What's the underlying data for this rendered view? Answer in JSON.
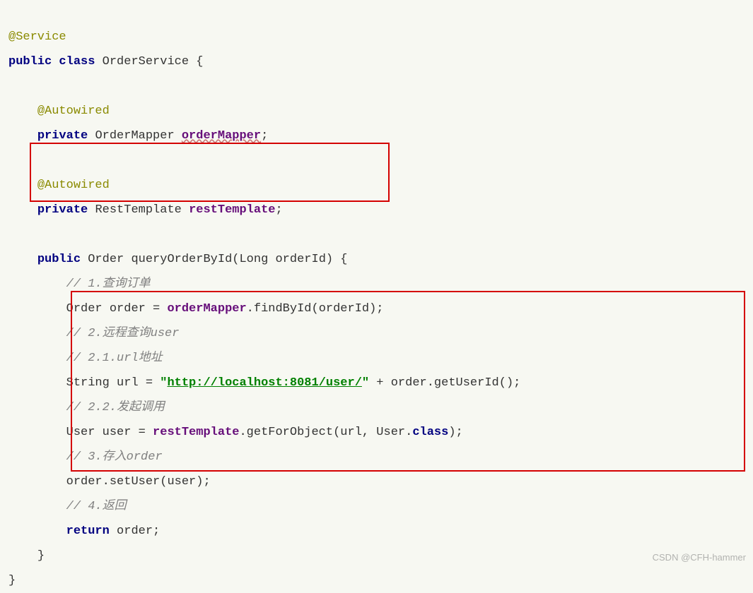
{
  "code": {
    "l1_annotation": "@Service",
    "l2_kw1": "public",
    "l2_kw2": "class",
    "l2_class": "OrderService {",
    "l4_annotation": "@Autowired",
    "l5_kw": "private",
    "l5_type": "OrderMapper",
    "l5_field": "orderMapper",
    "l5_semi": ";",
    "l7_annotation": "@Autowired",
    "l8_kw": "private",
    "l8_type": "RestTemplate",
    "l8_field": "restTemplate",
    "l8_semi": ";",
    "l10_kw": "public",
    "l10_rest": "Order queryOrderById(Long orderId) {",
    "l11_comment": "// 1.查询订单",
    "l12_a": "Order order = ",
    "l12_field": "orderMapper",
    "l12_b": ".findById(orderId);",
    "l13_comment": "// 2.远程查询user",
    "l14_comment": "// 2.1.url地址",
    "l15_a": "String url = ",
    "l15_str_q1": "\"",
    "l15_str_url": "http://localhost:8081/user/",
    "l15_str_q2": "\"",
    "l15_b": " + order.getUserId();",
    "l16_comment": "// 2.2.发起调用",
    "l17_a": "User user = ",
    "l17_field": "restTemplate",
    "l17_b": ".getForObject(url, User.",
    "l17_kw": "class",
    "l17_c": ");",
    "l18_comment": "// 3.存入order",
    "l19": "order.setUser(user);",
    "l20_comment": "// 4.返回",
    "l21_kw": "return",
    "l21_rest": " order;",
    "l22": "}",
    "l23": "}"
  },
  "watermark": "CSDN @CFH-hammer"
}
